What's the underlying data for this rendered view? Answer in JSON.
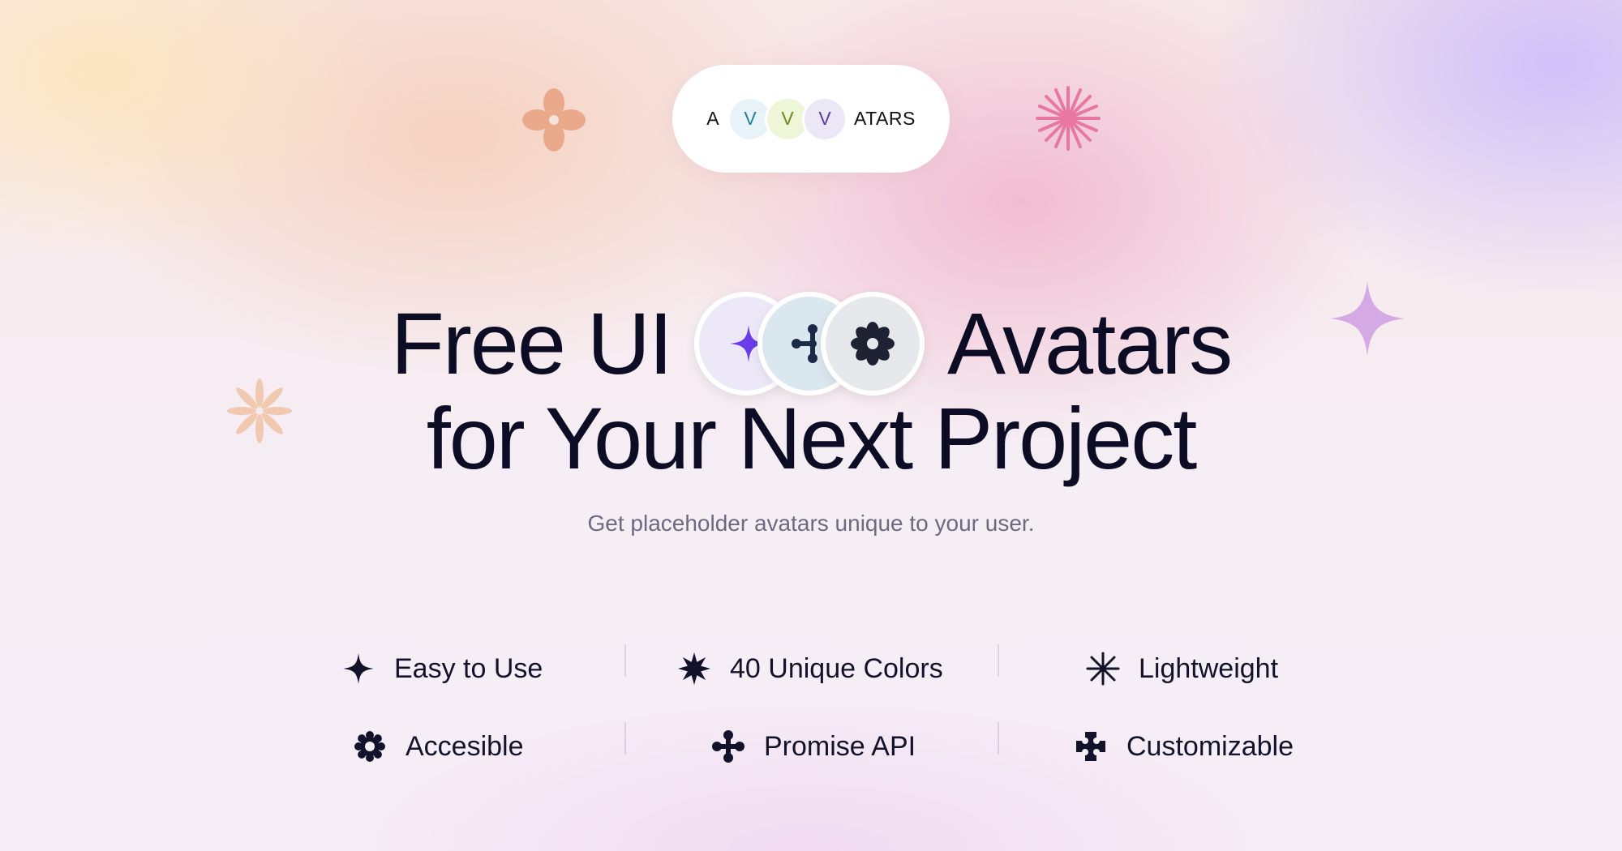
{
  "logo": {
    "prefix": "A",
    "letters": [
      {
        "char": "V",
        "bg": "#e7f3f8",
        "color": "#2a7d9d"
      },
      {
        "char": "V",
        "bg": "#eef6d8",
        "color": "#6c8a1d"
      },
      {
        "char": "V",
        "bg": "#ece7f7",
        "color": "#5a3d9e"
      }
    ],
    "suffix": "ATARS"
  },
  "hero": {
    "line1_left": "Free UI",
    "line1_right": "Avatars",
    "line2": "for Your Next Project",
    "subtitle": "Get placeholder avatars unique to your user.",
    "avatars": [
      {
        "icon": "four-point-star-icon",
        "bg": "#ece8f8",
        "color": "#6a3de8"
      },
      {
        "icon": "molecule-icon",
        "bg": "#dbe7ee",
        "color": "#1c2a4a"
      },
      {
        "icon": "flower-icon",
        "bg": "#e6e8ec",
        "color": "#1e2233"
      }
    ]
  },
  "features": [
    {
      "label": "Easy to Use",
      "icon": "four-point-star-icon"
    },
    {
      "label": "40 Unique Colors",
      "icon": "burst-star-icon"
    },
    {
      "label": "Lightweight",
      "icon": "asterisk-icon"
    },
    {
      "label": "Accesible",
      "icon": "gear-flower-icon"
    },
    {
      "label": "Promise API",
      "icon": "four-dots-icon"
    },
    {
      "label": "Customizable",
      "icon": "cross-star-icon"
    }
  ],
  "decorations": {
    "colors": {
      "petal_orange": "#eba98c",
      "burst_pink": "#e8789f",
      "star_purple": "#cf9ee0",
      "flower_peach": "#f1c9b0"
    }
  }
}
